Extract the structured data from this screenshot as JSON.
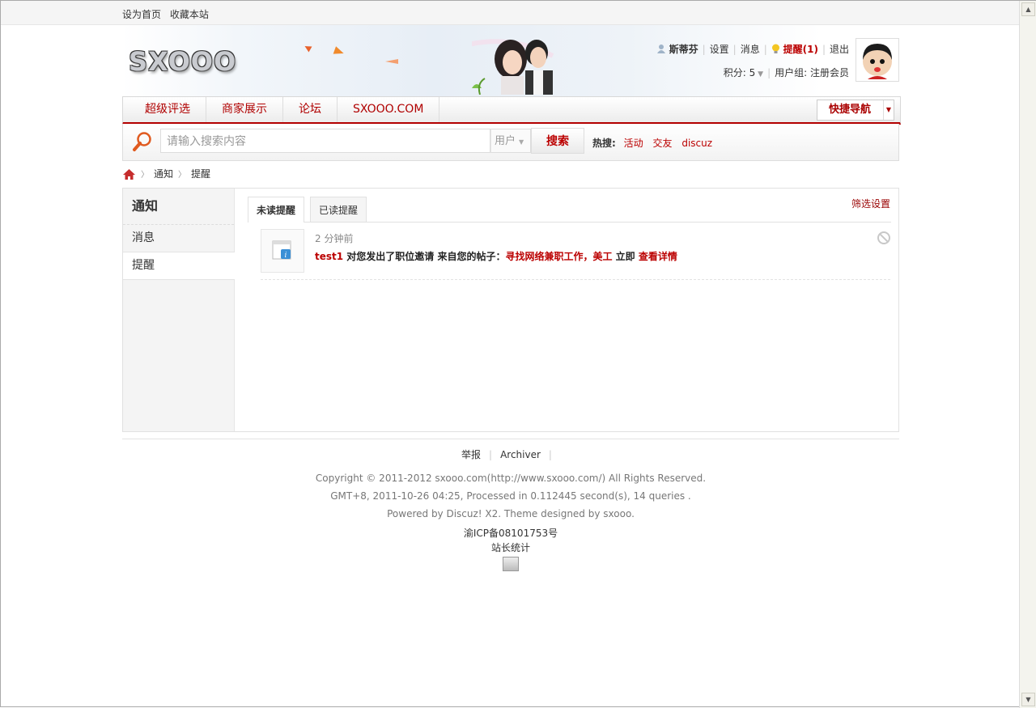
{
  "topbar": {
    "set_home": "设为首页",
    "bookmark": "收藏本站"
  },
  "header": {
    "logo": "SXOOO",
    "user": {
      "name": "斯蒂芬",
      "settings": "设置",
      "messages": "消息",
      "reminders": "提醒(1)",
      "logout": "退出"
    },
    "points_label": "积分: 5",
    "usergroup_label": "用户组: 注册会员"
  },
  "nav": {
    "items": [
      "超级评选",
      "商家展示",
      "论坛",
      "SXOOO.COM"
    ],
    "quick_nav": "快捷导航"
  },
  "search": {
    "placeholder": "请输入搜索内容",
    "type": "用户",
    "button": "搜索",
    "hot_label": "热搜:",
    "hot": [
      "活动",
      "交友",
      "discuz"
    ]
  },
  "breadcrumb": [
    "通知",
    "提醒"
  ],
  "sidebar": {
    "title": "通知",
    "items": [
      "消息",
      "提醒"
    ]
  },
  "tabs": {
    "unread": "未读提醒",
    "read": "已读提醒",
    "filter": "筛选设置"
  },
  "notice": {
    "time": "2 分钟前",
    "user": "test1",
    "text1": " 对您发出了职位邀请 来自您的帖子：",
    "post": "寻找网络兼职工作，美工",
    "text2": " 立即 ",
    "link": "查看详情"
  },
  "footer": {
    "links": [
      "举报",
      "Archiver"
    ],
    "copyright": "Copyright © 2011-2012 sxooo.com(http://www.sxooo.com/) All Rights Reserved.",
    "processed": "GMT+8, 2011-10-26 04:25, Processed in 0.112445 second(s), 14 queries .",
    "powered": "Powered by Discuz! X2. Theme designed by sxooo.",
    "icp": "渝ICP备08101753号",
    "stats": "站长统计"
  },
  "colors": {
    "accent": "#b30000",
    "link_red": "#bb0000"
  }
}
